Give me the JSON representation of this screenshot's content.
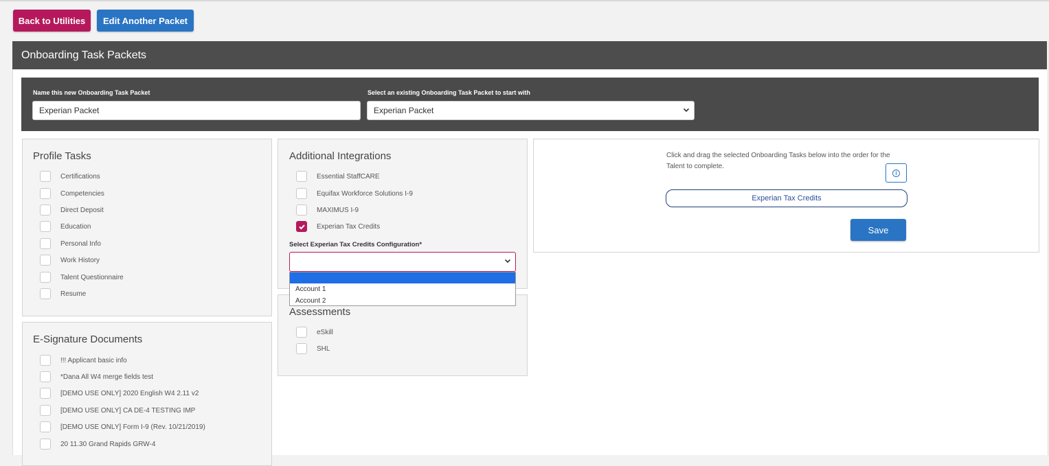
{
  "header_buttons": {
    "back": "Back to Utilities",
    "edit": "Edit Another Packet"
  },
  "page_title": "Onboarding Task Packets",
  "form": {
    "name_label": "Name this new Onboarding Task Packet",
    "name_value": "Experian Packet",
    "existing_label": "Select an existing Onboarding Task Packet to start with",
    "existing_value": "Experian Packet"
  },
  "profile_tasks": {
    "title": "Profile Tasks",
    "items": [
      "Certifications",
      "Competencies",
      "Direct Deposit",
      "Education",
      "Personal Info",
      "Work History",
      "Talent Questionnaire",
      "Resume"
    ]
  },
  "additional_integrations": {
    "title": "Additional Integrations",
    "items": [
      {
        "label": "Essential StaffCARE",
        "checked": false
      },
      {
        "label": "Equifax Workforce Solutions I-9",
        "checked": false
      },
      {
        "label": "MAXIMUS I-9",
        "checked": false
      },
      {
        "label": "Experian Tax Credits",
        "checked": true
      }
    ],
    "config_label": "Select Experian Tax Credits Configuration*",
    "config_value": "",
    "config_options": [
      "",
      "Account 1",
      "Account 2"
    ]
  },
  "assessments": {
    "title": "Assessments",
    "items": [
      "eSkill",
      "SHL"
    ]
  },
  "esignature": {
    "title": "E-Signature Documents",
    "items": [
      "!!! Applicant basic info",
      "*Dana All W4 merge fields test",
      "[DEMO USE ONLY] 2020 English W4 2.11 v2",
      "[DEMO USE ONLY] CA DE-4 TESTING IMP",
      "[DEMO USE ONLY] Form I-9 (Rev. 10/21/2019)",
      "20 11.30 Grand Rapids GRW-4"
    ]
  },
  "order_panel": {
    "instruction": "Click and drag the selected Onboarding Tasks below into the order for the Talent to complete.",
    "selected_tasks": [
      "Experian Tax Credits"
    ],
    "save_label": "Save"
  },
  "colors": {
    "primary_magenta": "#b5195b",
    "primary_blue": "#2a74c4",
    "dark_bar": "#4d4d4d"
  }
}
